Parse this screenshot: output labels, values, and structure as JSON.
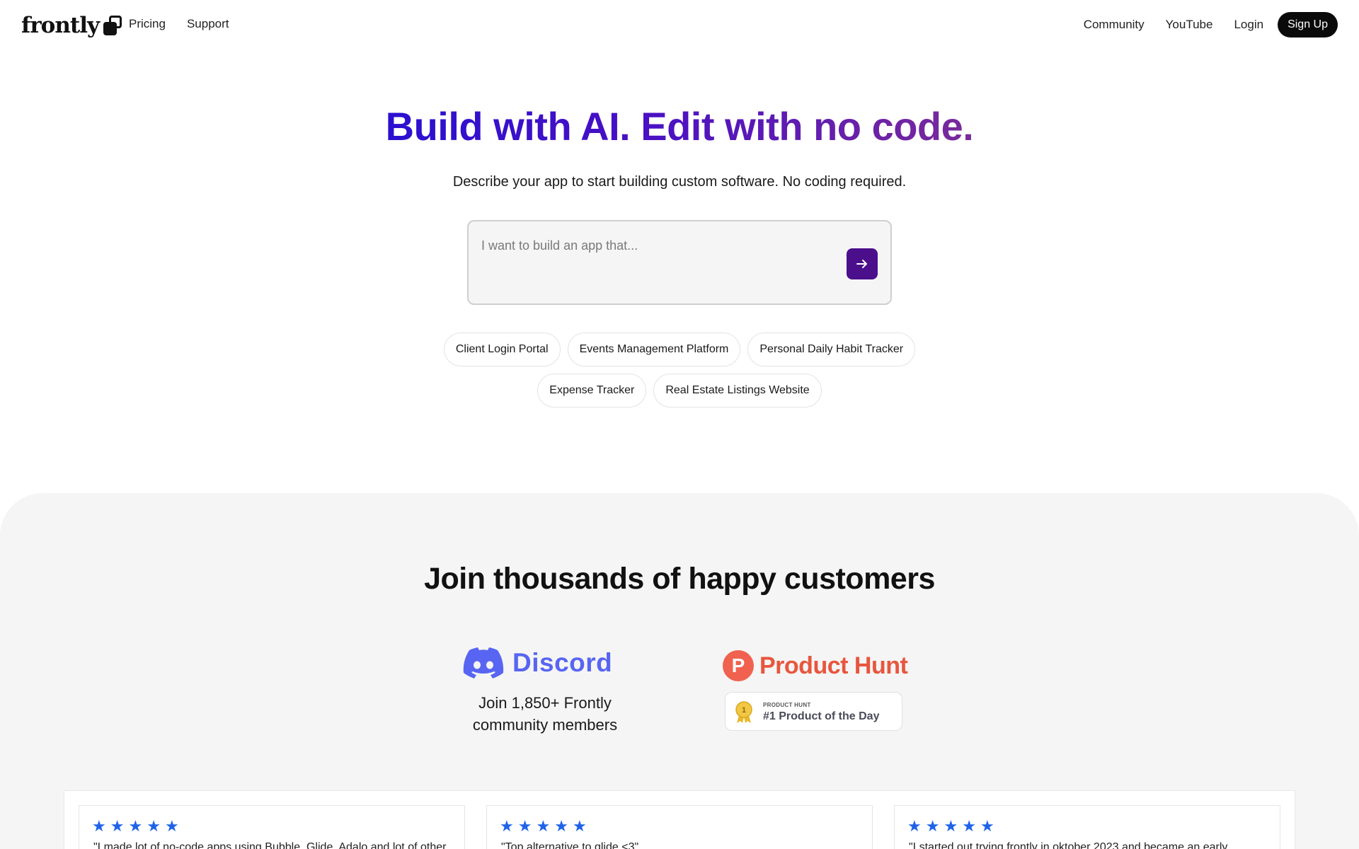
{
  "nav": {
    "logo": "frontly",
    "left": [
      "Pricing",
      "Support"
    ],
    "right": [
      "Community",
      "YouTube",
      "Login"
    ],
    "signup": "Sign Up"
  },
  "hero": {
    "title": "Build with AI. Edit with no code.",
    "subtitle": "Describe your app to start building custom software. No coding required.",
    "placeholder": "I want to build an app that...",
    "chips_row1": [
      "Client Login Portal",
      "Events Management Platform",
      "Personal Daily Habit Tracker"
    ],
    "chips_row2": [
      "Expense Tracker",
      "Real Estate Listings Website"
    ],
    "accent_color": "#4b0f8c"
  },
  "customers": {
    "title": "Join thousands of happy customers",
    "discord": {
      "name": "Discord",
      "text": "Join 1,850+ Frontly community members",
      "color": "#5865f2"
    },
    "product_hunt": {
      "name": "Product Hunt",
      "badge_small": "PRODUCT HUNT",
      "badge_big": "#1 Product of the Day",
      "color": "#f0624f"
    },
    "reviews": [
      {
        "stars": 5,
        "text": "\"I made lot of no-code apps using Bubble, Glide, Adalo and lot of other"
      },
      {
        "stars": 5,
        "text": "\"Top alternative to glide <3\""
      },
      {
        "stars": 5,
        "text": "\"I started out trying frontly in oktober 2023 and became an early"
      }
    ]
  }
}
